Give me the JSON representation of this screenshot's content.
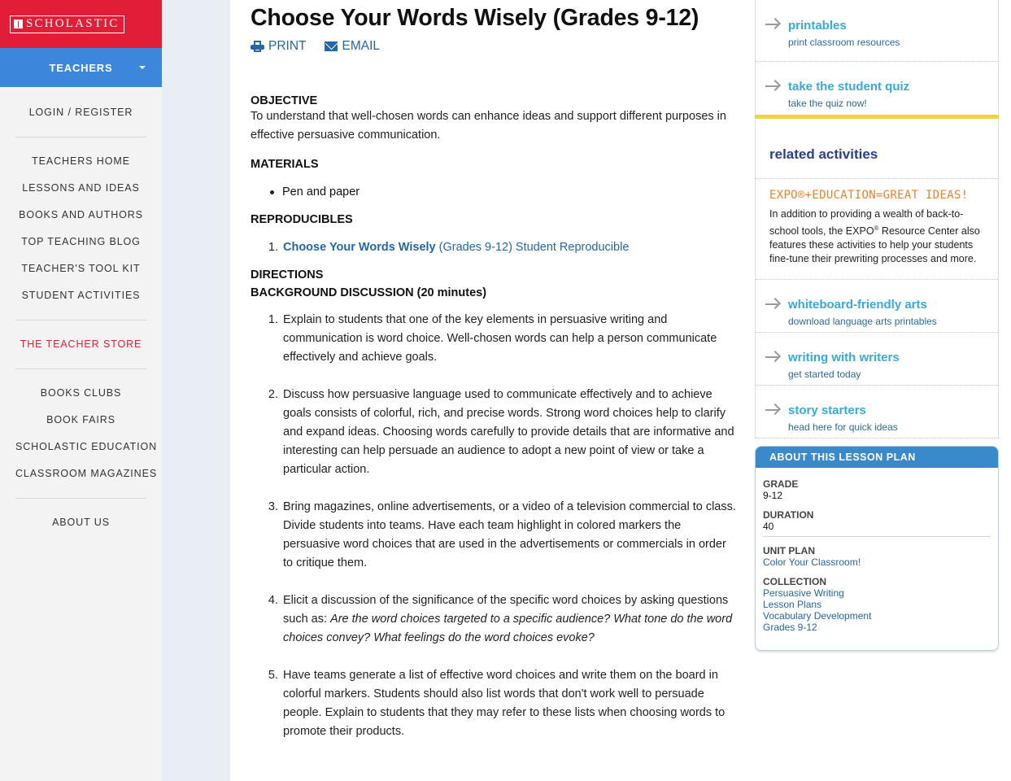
{
  "brand": {
    "logo_text": "SCHOLASTIC",
    "accent": "#e21d38",
    "nav_blue": "#3c87dc"
  },
  "sidebar": {
    "audience": "TEACHERS",
    "login": "LOGIN / REGISTER",
    "group1": [
      "TEACHERS HOME",
      "LESSONS AND IDEAS",
      "BOOKS AND AUTHORS",
      "TOP TEACHING BLOG",
      "TEACHER'S TOOL KIT",
      "STUDENT ACTIVITIES"
    ],
    "store": "THE TEACHER STORE",
    "group2": [
      "BOOKS CLUBS",
      "BOOK FAIRS",
      "SCHOLASTIC EDUCATION",
      "CLASSROOM MAGAZINES"
    ],
    "about": "ABOUT US"
  },
  "article": {
    "title": "Choose Your Words Wisely (Grades 9-12)",
    "print_label": "PRINT",
    "email_label": "EMAIL",
    "objective_heading": "OBJECTIVE",
    "objective_text": "To understand that well-chosen words can enhance ideas and support different purposes in effective persuasive communication.",
    "materials_heading": "MATERIALS",
    "materials": [
      "Pen and paper"
    ],
    "reproducibles_heading": "REPRODUCIBLES",
    "reproducible_link_bold": "Choose Your Words Wisely",
    "reproducible_link_rest": " (Grades 9-12) Student Reproducible",
    "directions_heading": "DIRECTIONS",
    "background_heading": "BACKGROUND DISCUSSION (20 minutes)",
    "steps": [
      "Explain to students that one of the key elements in persuasive writing and communication is word choice. Well-chosen words can help a person communicate effectively and achieve goals.",
      "Discuss how persuasive language used to communicate effectively and to achieve goals consists of colorful, rich, and precise words. Strong word choices help to clarify and expand ideas. Choosing words carefully to provide details that are informative and interesting can help persuade an audience to adopt a new point of view or take a particular action.",
      "Bring magazines, online advertisements, or a video of a television commercial to class. Divide students into teams. Have each team highlight in colored markers the persuasive word choices that are used in the advertisements or commercials in order to critique them."
    ],
    "step4_plain": "Elicit a discussion of the significance of the specific word choices by asking questions such as: ",
    "step4_italic": "Are the word choices targeted to a specific audience? What tone do the word choices convey? What feelings do the word choices evoke?",
    "step5": "Have teams generate a list of effective word choices and write them on the board in colorful markers. Students should also list words that don't work well to persuade people. Explain to students that they may refer to these lists when choosing words to promote their products."
  },
  "right": {
    "top_promos": [
      {
        "title": "printables",
        "sub": "print classroom resources"
      },
      {
        "title": "take the student quiz",
        "sub": "take the quiz now!"
      }
    ],
    "related_heading": "related activities",
    "expo_logo": "EXPO®+EDUCATION=GREAT IDEAS!",
    "expo_text_1": "In addition to providing a wealth of back-to-school tools, the EXPO",
    "expo_reg": "®",
    "expo_text_2": " Resource Center also features these activities to help your students fine-tune their prewriting processes and more.",
    "promos": [
      {
        "title": "whiteboard-friendly arts",
        "sub": "download language arts printables"
      },
      {
        "title": "writing with writers",
        "sub": "get started today"
      },
      {
        "title": "story starters",
        "sub": "head here for quick ideas"
      }
    ]
  },
  "about": {
    "heading": "ABOUT THIS LESSON PLAN",
    "grade_label": "GRADE",
    "grade": "9-12",
    "duration_label": "DURATION",
    "duration": "40",
    "unit_label": "UNIT PLAN",
    "unit": "Color Your Classroom!",
    "collection_label": "COLLECTION",
    "collection": [
      "Persuasive Writing",
      "Lesson Plans",
      "Vocabulary Development",
      "Grades 9-12"
    ]
  }
}
